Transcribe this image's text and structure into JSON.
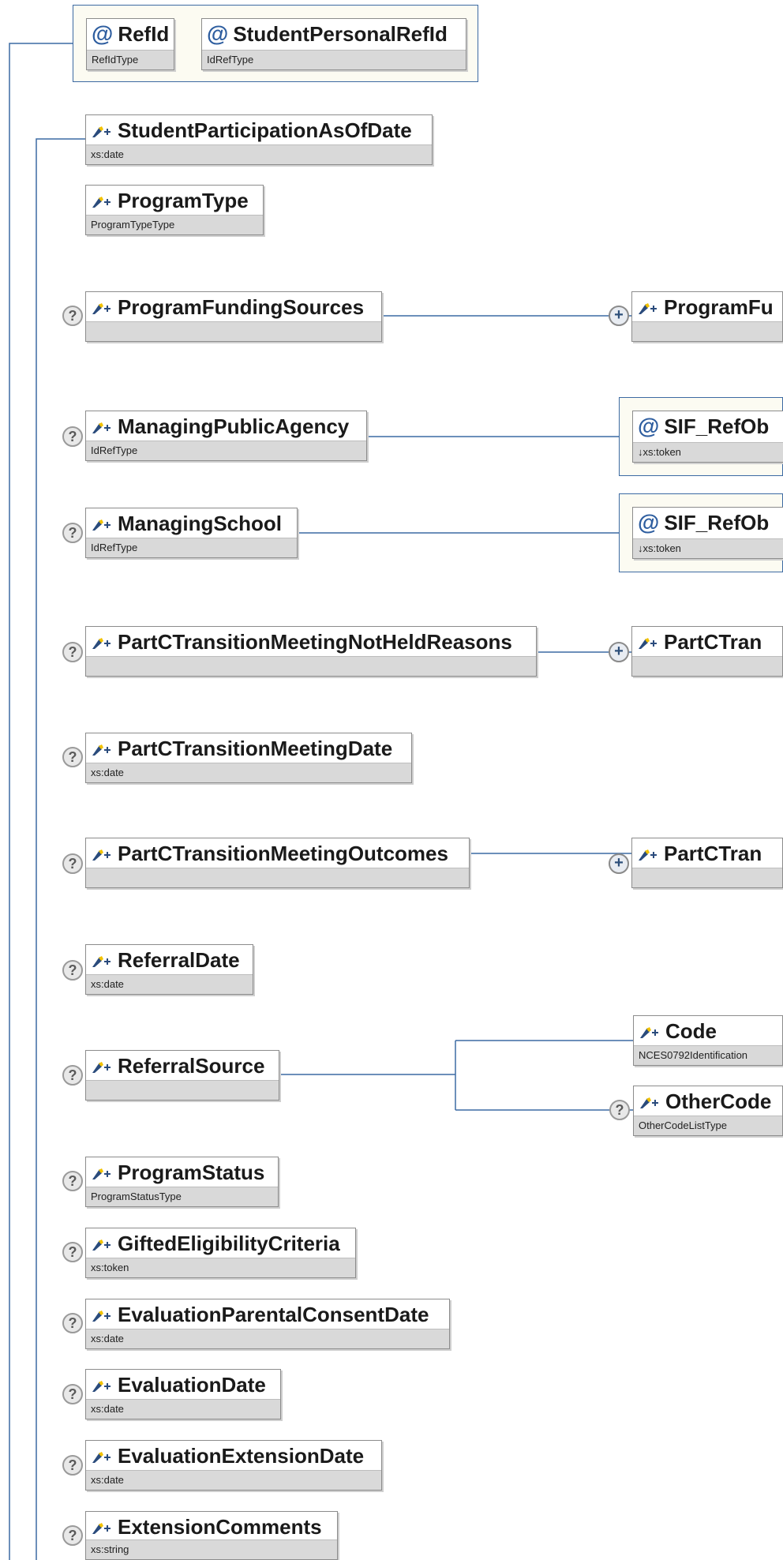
{
  "header_group": {
    "refid": {
      "name": "RefId",
      "type": "RefIdType"
    },
    "student_personal_refid": {
      "name": "StudentPersonalRefId",
      "type": "IdRefType"
    }
  },
  "elements": {
    "student_participation_as_of_date": {
      "name": "StudentParticipationAsOfDate",
      "type": "xs:date"
    },
    "program_type": {
      "name": "ProgramType",
      "type": "ProgramTypeType"
    },
    "program_funding_sources": {
      "name": "ProgramFundingSources",
      "type": ""
    },
    "managing_public_agency": {
      "name": "ManagingPublicAgency",
      "type": "IdRefType"
    },
    "managing_school": {
      "name": "ManagingSchool",
      "type": "IdRefType"
    },
    "partc_not_held_reasons": {
      "name": "PartCTransitionMeetingNotHeldReasons",
      "type": ""
    },
    "partc_meeting_date": {
      "name": "PartCTransitionMeetingDate",
      "type": "xs:date"
    },
    "partc_meeting_outcomes": {
      "name": "PartCTransitionMeetingOutcomes",
      "type": ""
    },
    "referral_date": {
      "name": "ReferralDate",
      "type": "xs:date"
    },
    "referral_source": {
      "name": "ReferralSource",
      "type": ""
    },
    "program_status": {
      "name": "ProgramStatus",
      "type": "ProgramStatusType"
    },
    "gifted_eligibility_criteria": {
      "name": "GiftedEligibilityCriteria",
      "type": "xs:token"
    },
    "evaluation_parental_consent_date": {
      "name": "EvaluationParentalConsentDate",
      "type": "xs:date"
    },
    "evaluation_date": {
      "name": "EvaluationDate",
      "type": "xs:date"
    },
    "evaluation_extension_date": {
      "name": "EvaluationExtensionDate",
      "type": "xs:date"
    },
    "extension_comments": {
      "name": "ExtensionComments",
      "type": "xs:string"
    }
  },
  "children": {
    "program_funding_child": {
      "name": "ProgramFu",
      "type": ""
    },
    "agency_sif_refobject": {
      "name": "SIF_RefOb",
      "type": "↓xs:token"
    },
    "school_sif_refobject": {
      "name": "SIF_RefOb",
      "type": "↓xs:token"
    },
    "not_held_reason_child": {
      "name": "PartCTran",
      "type": ""
    },
    "outcome_child": {
      "name": "PartCTran",
      "type": ""
    },
    "code": {
      "name": "Code",
      "type": "NCES0792Identification"
    },
    "other_code_list": {
      "name": "OtherCode",
      "type": "OtherCodeListType"
    }
  },
  "glyphs": {
    "optional": "?",
    "expand": "+",
    "attribute": "@"
  },
  "colors": {
    "connector": "#3c6aa3",
    "group_bg": "#fcfbf2",
    "type_bar": "#d9d9d9"
  }
}
